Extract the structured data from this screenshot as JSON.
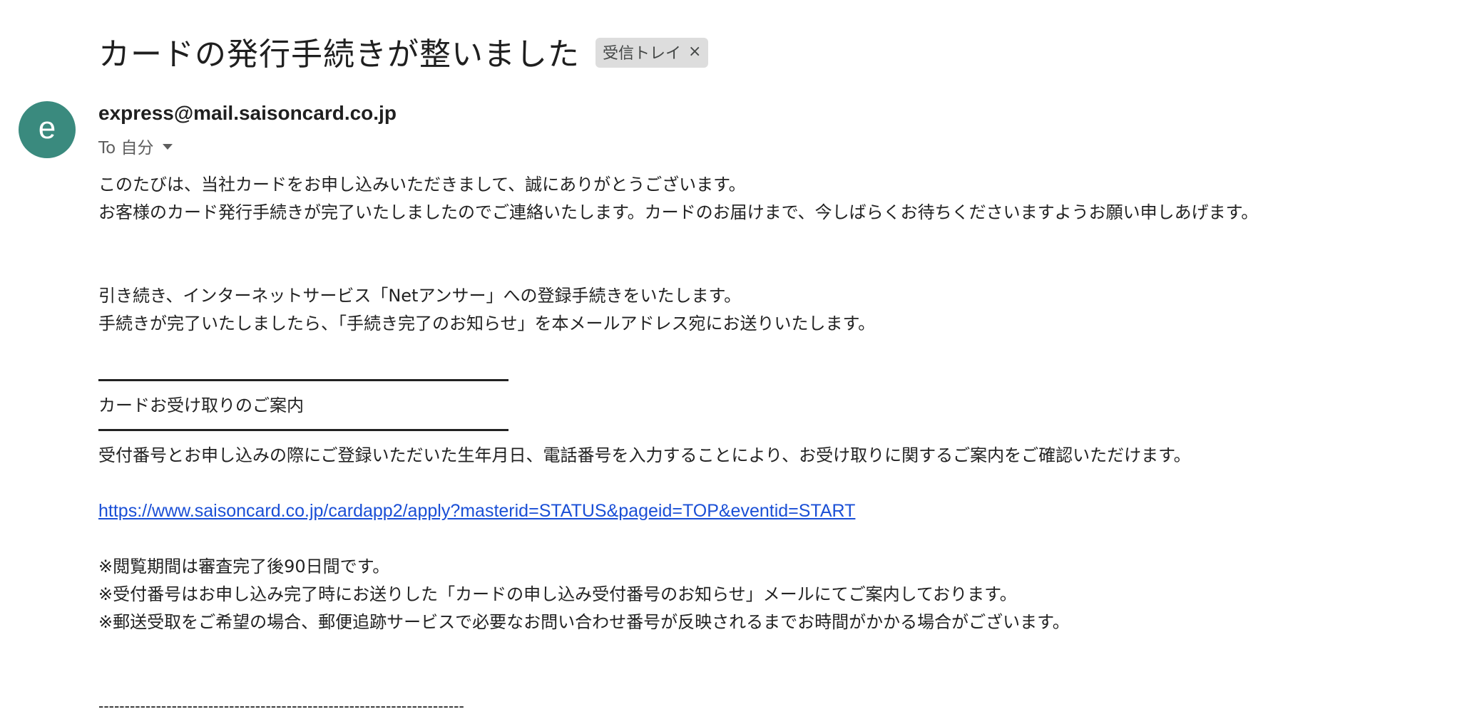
{
  "email": {
    "subject": "カードの発行手続きが整いました",
    "label": "受信トレイ",
    "label_close": "×",
    "avatar_letter": "e",
    "sender": "express@mail.saisoncard.co.jp",
    "recipient": "To 自分",
    "avatar_color": "#3a8a7e"
  },
  "body": {
    "p1_line1": "このたびは、当社カードをお申し込みいただきまして、誠にありがとうございます。",
    "p1_line2": "お客様のカード発行手続きが完了いたしましたのでご連絡いたします。カードのお届けまで、今しばらくお待ちくださいますようお願い申しあげます。",
    "p2_line1": "引き続き、インターネットサービス「Netアンサー」への登録手続きをいたします。",
    "p2_line2": "手続きが完了いたしましたら、「手続き完了のお知らせ」を本メールアドレス宛にお送りいたします。",
    "section_title": "カードお受け取りのご案内",
    "section_text": "受付番号とお申し込みの際にご登録いただいた生年月日、電話番号を入力することにより、お受け取りに関するご案内をご確認いただけます。",
    "link": "https://www.saisoncard.co.jp/cardapp2/apply?masterid=STATUS&pageid=TOP&eventid=START",
    "note1": "※閲覧期間は審査完了後90日間です。",
    "note2": "※受付番号はお申し込み完了時にお送りした「カードの申し込み受付番号のお知らせ」メールにてご案内しております。",
    "note3": "※郵送受取をご希望の場合、郵便追跡サービスで必要なお問い合わせ番号が反映されるまでお時間がかかる場合がございます。",
    "divider": "----------------------------------------------------------------------"
  },
  "colors": {
    "link": "#1a4fd6",
    "chip_bg": "#dddddd"
  }
}
